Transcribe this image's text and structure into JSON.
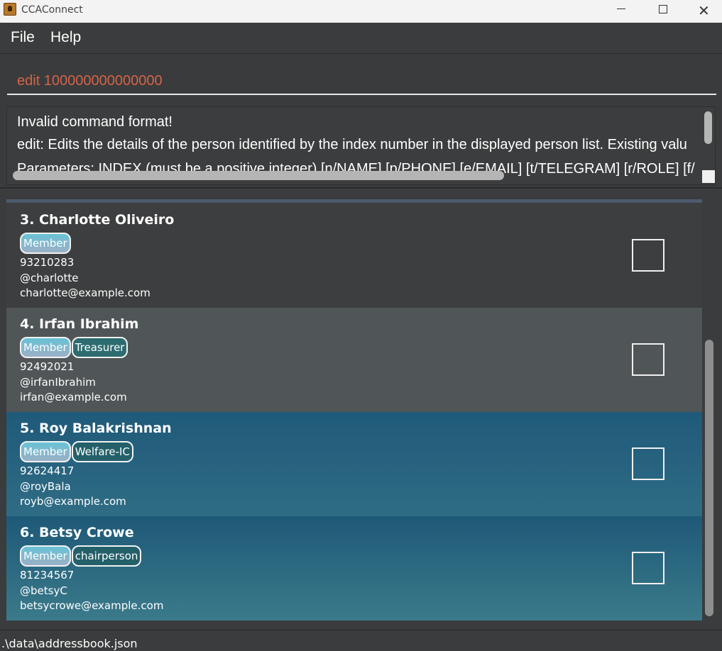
{
  "window": {
    "title": "CCAConnect",
    "min_icon": "minimize-icon",
    "max_icon": "maximize-icon",
    "close_icon": "close-icon",
    "close_glyph": "✕"
  },
  "menu": {
    "file": "File",
    "help": "Help"
  },
  "command": {
    "value": "edit 100000000000000",
    "error_color": "#d4644a"
  },
  "result": {
    "line1": "Invalid command format!",
    "line2": "edit: Edits the details of the person identified by the index number in the displayed person list. Existing valu",
    "line3": "Parameters: INDEX (must be a positive integer) [n/NAME] [p/PHONE] [e/EMAIL] [t/TELEGRAM] [r/ROLE] [f/"
  },
  "persons": [
    {
      "name": "3. Charlotte Oliveiro",
      "tags": [
        "Member"
      ],
      "phone": "93210283",
      "telegram": "@charlotte",
      "email": "charlotte@example.com"
    },
    {
      "name": "4. Irfan Ibrahim",
      "tags": [
        "Member",
        "Treasurer"
      ],
      "phone": "92492021",
      "telegram": "@irfanIbrahim",
      "email": "irfan@example.com"
    },
    {
      "name": "5. Roy Balakrishnan",
      "tags": [
        "Member",
        "Welfare-IC"
      ],
      "phone": "92624417",
      "telegram": "@royBala",
      "email": "royb@example.com"
    },
    {
      "name": "6. Betsy Crowe",
      "tags": [
        "Member",
        "chairperson"
      ],
      "phone": "81234567",
      "telegram": "@betsyC",
      "email": "betsycrowe@example.com"
    }
  ],
  "status": {
    "path": ".\\data\\addressbook.json"
  }
}
